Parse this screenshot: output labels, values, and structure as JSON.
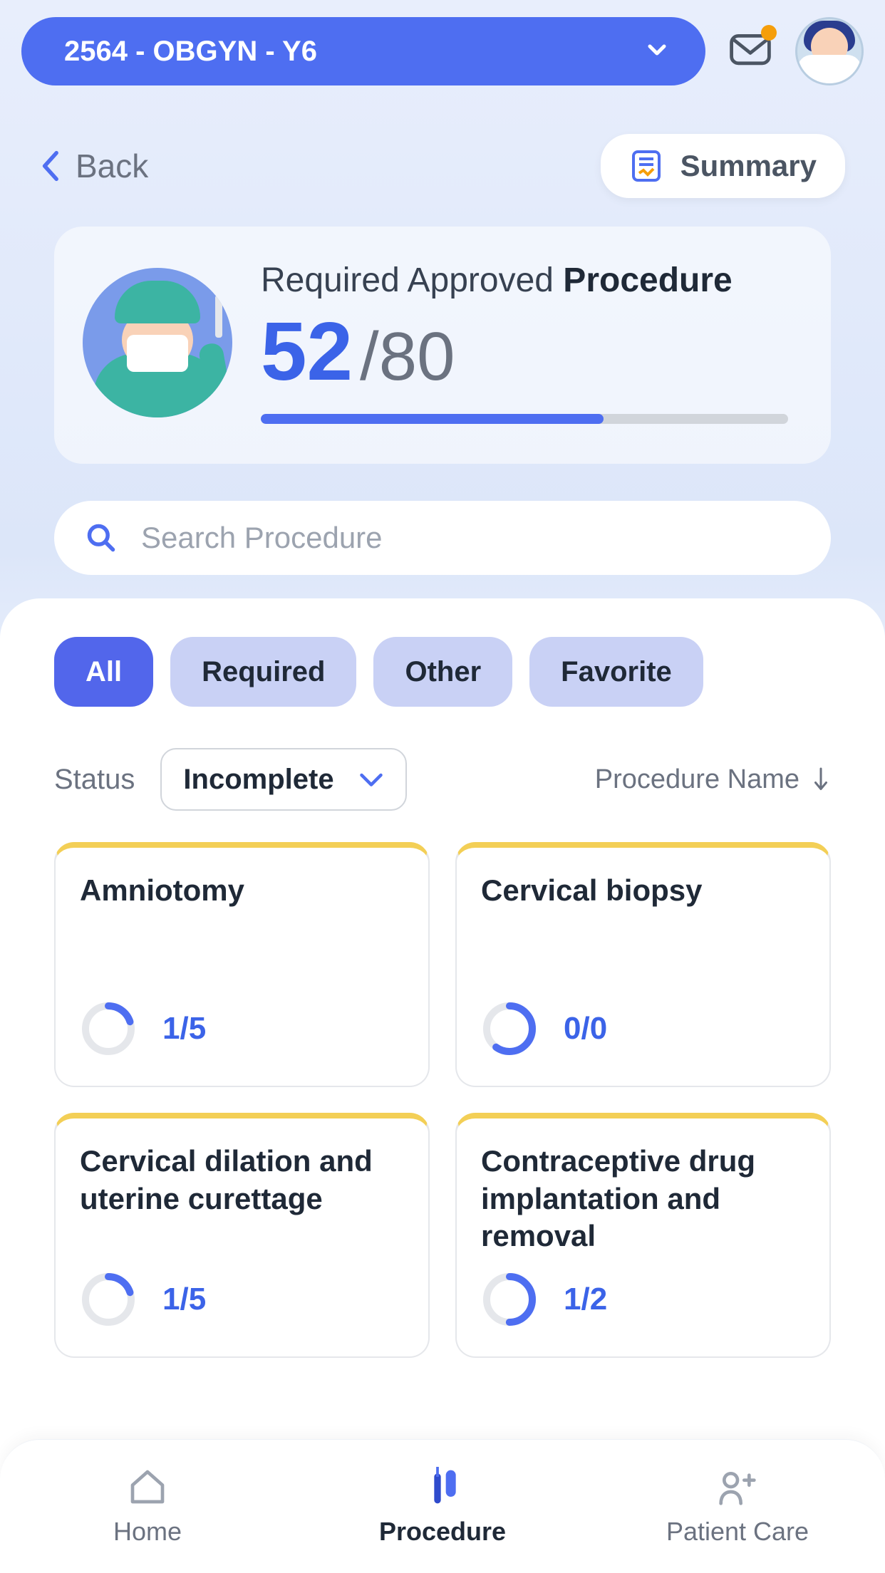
{
  "header": {
    "program_label": "2564 - OBGYN - Y6"
  },
  "subhead": {
    "back_label": "Back",
    "summary_label": "Summary"
  },
  "progress": {
    "title_prefix": "Required Approved ",
    "title_bold": "Procedure",
    "current": "52",
    "total": "/80",
    "percent": 65
  },
  "search": {
    "placeholder": "Search Procedure"
  },
  "filters": {
    "chips": [
      {
        "label": "All",
        "active": true
      },
      {
        "label": "Required",
        "active": false
      },
      {
        "label": "Other",
        "active": false
      },
      {
        "label": "Favorite",
        "active": false
      }
    ],
    "status_label": "Status",
    "status_value": "Incomplete",
    "sort_label": "Procedure Name"
  },
  "procedures": [
    {
      "name": "Amniotomy",
      "done": 1,
      "total": 5,
      "fraction": "1/5",
      "ring_pct": 20
    },
    {
      "name": "Cervical biopsy",
      "done": 0,
      "total": 0,
      "fraction": "0/0",
      "ring_pct": 60
    },
    {
      "name": "Cervical dilation and uterine curettage",
      "done": 1,
      "total": 5,
      "fraction": "1/5",
      "ring_pct": 20
    },
    {
      "name": "Contraceptive drug implantation and removal",
      "done": 1,
      "total": 2,
      "fraction": "1/2",
      "ring_pct": 50
    }
  ],
  "nav": {
    "items": [
      {
        "label": "Home",
        "active": false
      },
      {
        "label": "Procedure",
        "active": true
      },
      {
        "label": "Patient Care",
        "active": false
      }
    ]
  },
  "colors": {
    "primary": "#4e6ef1",
    "accent_yellow": "#f3cf56",
    "text_dark": "#1f2937",
    "text_muted": "#6b7280"
  }
}
